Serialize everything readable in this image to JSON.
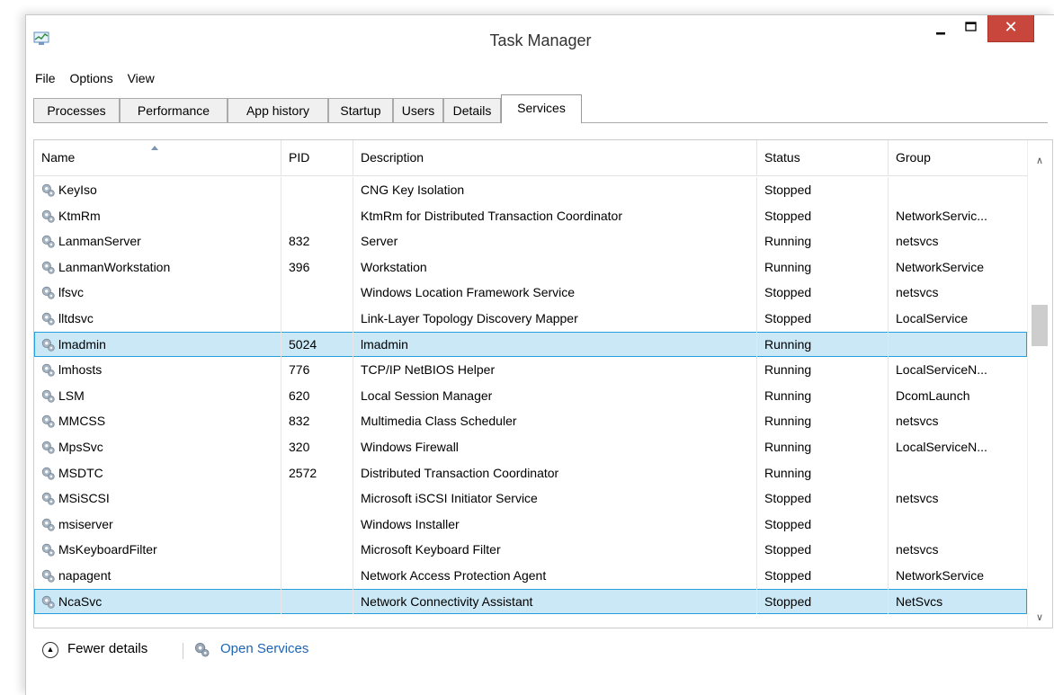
{
  "window": {
    "title": "Task Manager",
    "close_glyph": "✕"
  },
  "menu": [
    "File",
    "Options",
    "View"
  ],
  "tabs": [
    "Processes",
    "Performance",
    "App history",
    "Startup",
    "Users",
    "Details",
    "Services"
  ],
  "active_tab": "Services",
  "columns": {
    "name": "Name",
    "pid": "PID",
    "description": "Description",
    "status": "Status",
    "group": "Group"
  },
  "rows": [
    {
      "name": "KeyIso",
      "pid": "",
      "description": "CNG Key Isolation",
      "status": "Stopped",
      "group": ""
    },
    {
      "name": "KtmRm",
      "pid": "",
      "description": "KtmRm for Distributed Transaction Coordinator",
      "status": "Stopped",
      "group": "NetworkServic..."
    },
    {
      "name": "LanmanServer",
      "pid": "832",
      "description": "Server",
      "status": "Running",
      "group": "netsvcs"
    },
    {
      "name": "LanmanWorkstation",
      "pid": "396",
      "description": "Workstation",
      "status": "Running",
      "group": "NetworkService"
    },
    {
      "name": "lfsvc",
      "pid": "",
      "description": "Windows Location Framework Service",
      "status": "Stopped",
      "group": "netsvcs"
    },
    {
      "name": "lltdsvc",
      "pid": "",
      "description": "Link-Layer Topology Discovery Mapper",
      "status": "Stopped",
      "group": "LocalService"
    },
    {
      "name": "lmadmin",
      "pid": "5024",
      "description": "lmadmin",
      "status": "Running",
      "group": "",
      "selected": true
    },
    {
      "name": "lmhosts",
      "pid": "776",
      "description": "TCP/IP NetBIOS Helper",
      "status": "Running",
      "group": "LocalServiceN..."
    },
    {
      "name": "LSM",
      "pid": "620",
      "description": "Local Session Manager",
      "status": "Running",
      "group": "DcomLaunch"
    },
    {
      "name": "MMCSS",
      "pid": "832",
      "description": "Multimedia Class Scheduler",
      "status": "Running",
      "group": "netsvcs"
    },
    {
      "name": "MpsSvc",
      "pid": "320",
      "description": "Windows Firewall",
      "status": "Running",
      "group": "LocalServiceN..."
    },
    {
      "name": "MSDTC",
      "pid": "2572",
      "description": "Distributed Transaction Coordinator",
      "status": "Running",
      "group": ""
    },
    {
      "name": "MSiSCSI",
      "pid": "",
      "description": "Microsoft iSCSI Initiator Service",
      "status": "Stopped",
      "group": "netsvcs"
    },
    {
      "name": "msiserver",
      "pid": "",
      "description": "Windows Installer",
      "status": "Stopped",
      "group": ""
    },
    {
      "name": "MsKeyboardFilter",
      "pid": "",
      "description": "Microsoft Keyboard Filter",
      "status": "Stopped",
      "group": "netsvcs"
    },
    {
      "name": "napagent",
      "pid": "",
      "description": "Network Access Protection Agent",
      "status": "Stopped",
      "group": "NetworkService"
    },
    {
      "name": "NcaSvc",
      "pid": "",
      "description": "Network Connectivity Assistant",
      "status": "Stopped",
      "group": "NetSvcs",
      "selected": true
    }
  ],
  "footer": {
    "fewer_details": "Fewer details",
    "open_services": "Open Services"
  },
  "colors": {
    "selection_bg": "#cbe8f6",
    "selection_border": "#26a0da",
    "link": "#1e64b4",
    "close_button": "#c9463d"
  },
  "icons": {
    "app": "task-manager-icon",
    "service": "service-gear-icon"
  }
}
